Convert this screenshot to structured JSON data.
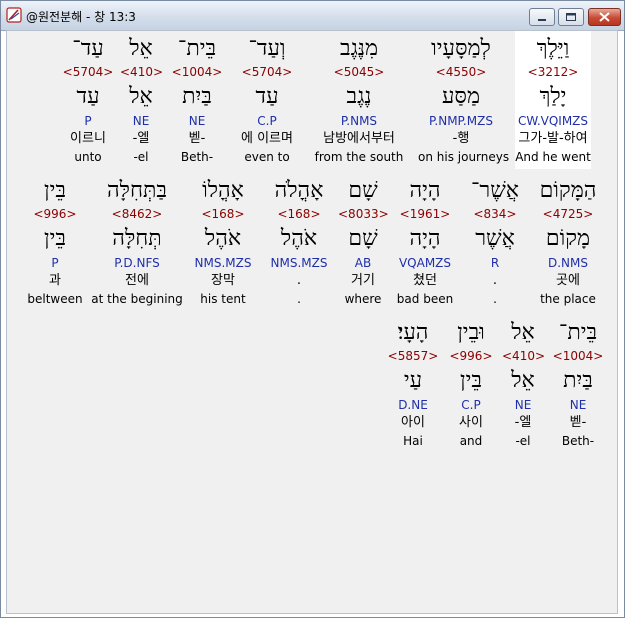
{
  "window": {
    "title": "@원전분해 - 창 13:3",
    "buttons": {
      "minimize": "minimize",
      "maximize": "maximize",
      "close": "close"
    }
  },
  "colors": {
    "strong": "#8b0000",
    "morph": "#1f2fa8",
    "highlight": "#ffffff"
  },
  "rows": [
    {
      "words": [
        {
          "hebrew": "וַיֵּלֶךְ",
          "strong": "<3212>",
          "lemma": "יָלַךְ",
          "morph": "CW.VQIMZS",
          "korean": "그가-발-하여",
          "english": "And he went",
          "highlighted": true
        },
        {
          "hebrew": "לְמַסָּעָיו",
          "strong": "<4550>",
          "lemma": "מַסַּע",
          "morph": "P.NMP.MZS",
          "korean": "-행",
          "english": "on his journeys",
          "highlighted": false
        },
        {
          "hebrew": "מִנֶּגֶב",
          "strong": "<5045>",
          "lemma": "נֶגֶב",
          "morph": "P.NMS",
          "korean": "남방에서부터",
          "english": "from the south",
          "highlighted": false
        },
        {
          "hebrew": "וְעַד־",
          "strong": "<5704>",
          "lemma": "עַד",
          "morph": "C.P",
          "korean": "에 이르며",
          "english": "even to",
          "highlighted": false
        },
        {
          "hebrew": "בֵּית־",
          "strong": "<1004>",
          "lemma": "בַּיִת",
          "morph": "NE",
          "korean": "벧-",
          "english": "Beth-",
          "highlighted": false
        },
        {
          "hebrew": "אֵל",
          "strong": "<410>",
          "lemma": "אֵל",
          "morph": "NE",
          "korean": "-엘",
          "english": "-el",
          "highlighted": false
        },
        {
          "hebrew": "עַד־",
          "strong": "<5704>",
          "lemma": "עַד",
          "morph": "P",
          "korean": "이르니",
          "english": "unto",
          "highlighted": false
        }
      ]
    },
    {
      "words": [
        {
          "hebrew": "הַמָּקוֹם",
          "strong": "<4725>",
          "lemma": "מָקוֹם",
          "morph": "D.NMS",
          "korean": "곳에",
          "english": "the place",
          "highlighted": false
        },
        {
          "hebrew": "אֲשֶׁר־",
          "strong": "<834>",
          "lemma": "אֲשֶׁר",
          "morph": "R",
          "korean": ".",
          "english": ".",
          "highlighted": false
        },
        {
          "hebrew": "הָיָה",
          "strong": "<1961>",
          "lemma": "הָיָה",
          "morph": "VQAMZS",
          "korean": "쳤던",
          "english": "bad been",
          "highlighted": false
        },
        {
          "hebrew": "שָׁם",
          "strong": "<8033>",
          "lemma": "שָׁם",
          "morph": "AB",
          "korean": "거기",
          "english": "where",
          "highlighted": false
        },
        {
          "hebrew": "אָהֳלֹה",
          "strong": "<168>",
          "lemma": "אֹהֶל",
          "morph": "NMS.MZS",
          "korean": ".",
          "english": ".",
          "highlighted": false
        },
        {
          "hebrew": "אָהֳלוֹ",
          "strong": "<168>",
          "lemma": "אֹהֶל",
          "morph": "NMS.MZS",
          "korean": "장막",
          "english": "his tent",
          "highlighted": false
        },
        {
          "hebrew": "בַּתְּחִלָּה",
          "strong": "<8462>",
          "lemma": "תְּחִלָּה",
          "morph": "P.D.NFS",
          "korean": "전에",
          "english": "at the begining",
          "highlighted": false
        },
        {
          "hebrew": "בֵּין",
          "strong": "<996>",
          "lemma": "בֵּין",
          "morph": "P",
          "korean": "과",
          "english": "beltween",
          "highlighted": false
        }
      ]
    },
    {
      "words": [
        {
          "hebrew": "בֵּית־",
          "strong": "<1004>",
          "lemma": "בַּיִת",
          "morph": "NE",
          "korean": "벧-",
          "english": "Beth-",
          "highlighted": false
        },
        {
          "hebrew": "אֵל",
          "strong": "<410>",
          "lemma": "אֵל",
          "morph": "NE",
          "korean": "-엘",
          "english": "-el",
          "highlighted": false
        },
        {
          "hebrew": "וּבֵין",
          "strong": "<996>",
          "lemma": "בֵּין",
          "morph": "C.P",
          "korean": "사이",
          "english": "and",
          "highlighted": false
        },
        {
          "hebrew": "הָעָי׃",
          "strong": "<5857>",
          "lemma": "עַי",
          "morph": "D.NE",
          "korean": "아이",
          "english": "Hai",
          "highlighted": false
        }
      ]
    }
  ]
}
